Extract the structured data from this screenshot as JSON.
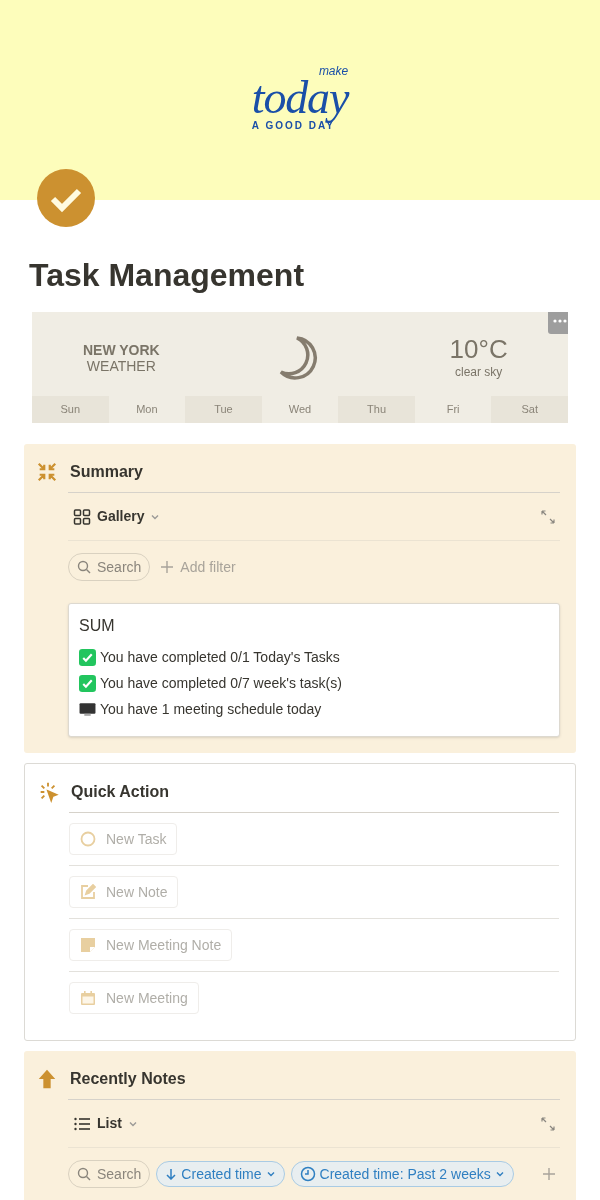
{
  "cover": {
    "logo_small": "make",
    "logo_main": "today",
    "logo_bottom": "A GOOD DAY"
  },
  "title": "Task Management",
  "weather": {
    "city": "NEW YORK",
    "label": "WEATHER",
    "temperature": "10°C",
    "condition": "clear sky",
    "days": [
      "Sun",
      "Mon",
      "Tue",
      "Wed",
      "Thu",
      "Fri",
      "Sat"
    ]
  },
  "sections": [
    {
      "kind": "database",
      "title": "Summary",
      "view": {
        "kind": "gallery",
        "label": "Gallery"
      },
      "search": "Search",
      "chips": [
        {
          "kind": "add",
          "label": "Add filter"
        }
      ],
      "card": {
        "title": "SUM",
        "lines": [
          {
            "kind": "task",
            "text": "You have completed 0/1 Today's Tasks"
          },
          {
            "kind": "task",
            "text": "You have completed 0/7 week's task(s)"
          },
          {
            "kind": "meeting",
            "text": "You have 1 meeting schedule today"
          }
        ]
      }
    },
    {
      "kind": "buttons",
      "title": "Quick Action",
      "buttons": [
        "New Task",
        "New Note",
        "New Meeting Note",
        "New Meeting"
      ]
    },
    {
      "kind": "database",
      "title": "Recently Notes",
      "view": {
        "kind": "list",
        "label": "List"
      },
      "search": "Search",
      "chips": [
        {
          "kind": "sort",
          "label": "Created time"
        },
        {
          "kind": "filter",
          "label": "Created time: Past 2 weeks"
        },
        {
          "kind": "plus"
        }
      ]
    }
  ]
}
